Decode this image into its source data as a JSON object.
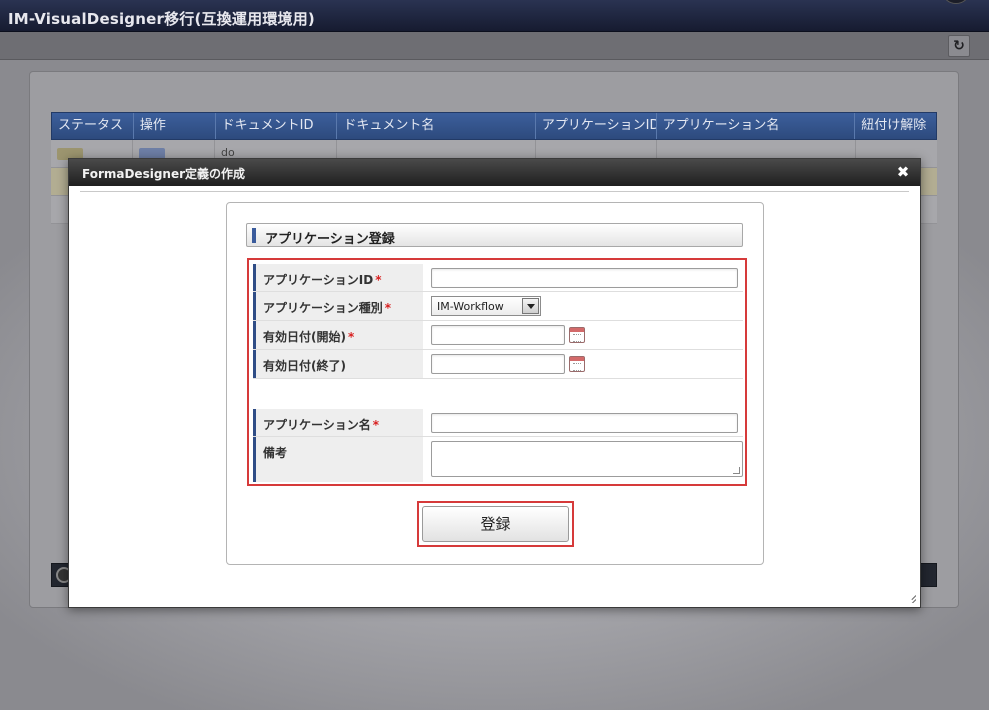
{
  "app": {
    "title": "IM-VisualDesigner移行(互換運用環境用)"
  },
  "toolbar": {
    "refresh_icon": "refresh-icon"
  },
  "grid": {
    "columns": [
      "ステータス",
      "操作",
      "ドキュメントID",
      "ドキュメント名",
      "アプリケーションID",
      "アプリケーション名",
      "紐付け解除"
    ],
    "rows": [
      {
        "document_id": "do"
      }
    ]
  },
  "dialog": {
    "title": "FormaDesigner定義の作成",
    "close_icon": "close-icon",
    "section_title": "アプリケーション登録",
    "fields": {
      "app_id": {
        "label": "アプリケーションID",
        "required": "*",
        "value": ""
      },
      "app_type": {
        "label": "アプリケーション種別",
        "required": "*",
        "value": "IM-Workflow"
      },
      "valid_from": {
        "label": "有効日付(開始)",
        "required": "*",
        "value": ""
      },
      "valid_to": {
        "label": "有効日付(終了)",
        "value": ""
      },
      "app_name": {
        "label": "アプリケーション名",
        "required": "*",
        "value": ""
      },
      "remarks": {
        "label": "備考",
        "value": ""
      }
    },
    "submit_label": "登録"
  },
  "colors": {
    "header_blue": "#2d4a7d",
    "dialog_titlebar": "#1f1f1f",
    "highlight_red": "#d63a3a",
    "required_red": "#d82020",
    "label_bar": "#2f4d86"
  }
}
